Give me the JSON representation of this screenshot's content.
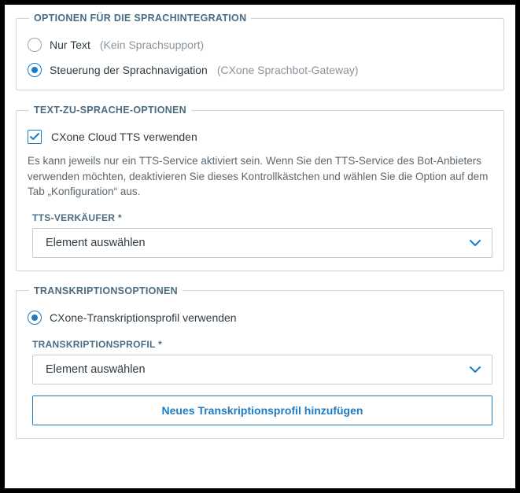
{
  "voice_integration": {
    "legend": "OPTIONEN FÜR DIE SPRACHINTEGRATION",
    "options": [
      {
        "label": "Nur Text",
        "hint": "(Kein Sprachsupport)",
        "checked": false
      },
      {
        "label": "Steuerung der Sprachnavigation",
        "hint": "(CXone Sprachbot-Gateway)",
        "checked": true
      }
    ]
  },
  "tts": {
    "legend": "TEXT-ZU-SPRACHE-OPTIONEN",
    "checkbox_label": "CXone Cloud TTS verwenden",
    "checkbox_checked": true,
    "help": "Es kann jeweils nur ein TTS-Service aktiviert sein. Wenn Sie den TTS-Service des Bot-Anbieters verwenden möchten, deaktivieren Sie dieses Kontrollkästchen und wählen Sie die Option auf dem Tab „Konfiguration“ aus.",
    "vendor_label": "TTS-VERKÄUFER *",
    "vendor_placeholder": "Element auswählen"
  },
  "transcription": {
    "legend": "TRANSKRIPTIONSOPTIONEN",
    "radio_label": "CXone-Transkriptionsprofil verwenden",
    "radio_checked": true,
    "profile_label": "TRANSKRIPTIONSPROFIL *",
    "profile_placeholder": "Element auswählen",
    "add_button": "Neues Transkriptionsprofil hinzufügen"
  }
}
